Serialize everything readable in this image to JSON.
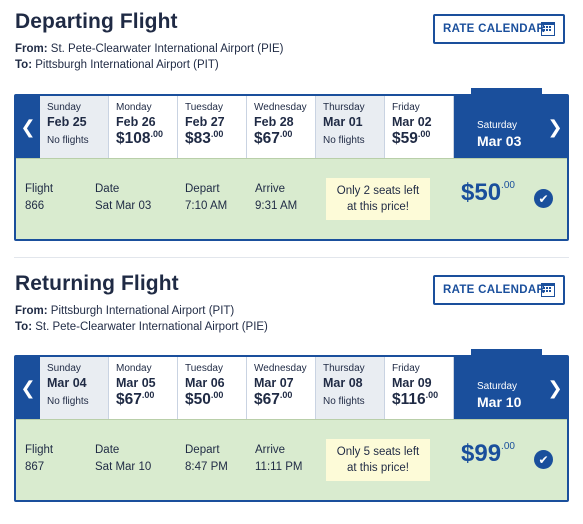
{
  "departing": {
    "title": "Departing Flight",
    "from_label": "From:",
    "from": "St. Pete-Clearwater International Airport (PIE)",
    "to_label": "To:",
    "to": "Pittsburgh International Airport (PIT)",
    "rate_calendar": "RATE CALENDAR",
    "days": [
      {
        "dow": "Sunday",
        "date": "Feb 25",
        "price": "",
        "cents": "",
        "note": "No flights",
        "grey": true
      },
      {
        "dow": "Monday",
        "date": "Feb 26",
        "price": "$108",
        "cents": ".00",
        "note": "",
        "grey": false
      },
      {
        "dow": "Tuesday",
        "date": "Feb 27",
        "price": "$83",
        "cents": ".00",
        "note": "",
        "grey": false
      },
      {
        "dow": "Wednesday",
        "date": "Feb 28",
        "price": "$67",
        "cents": ".00",
        "note": "",
        "grey": false
      },
      {
        "dow": "Thursday",
        "date": "Mar 01",
        "price": "",
        "cents": "",
        "note": "No flights",
        "grey": true
      },
      {
        "dow": "Friday",
        "date": "Mar 02",
        "price": "$59",
        "cents": ".00",
        "note": "",
        "grey": false
      }
    ],
    "selected": {
      "dow": "Saturday",
      "date": "Mar 03"
    },
    "flight_label": "Flight",
    "flight": "866",
    "date_label": "Date",
    "date": "Sat Mar 03",
    "depart_label": "Depart",
    "depart": "7:10 AM",
    "arrive_label": "Arrive",
    "arrive": "9:31 AM",
    "seats_line1": "Only 2 seats left",
    "seats_line2": "at this price!",
    "price": "$50",
    "price_cents": ".00"
  },
  "returning": {
    "title": "Returning Flight",
    "from_label": "From:",
    "from": "Pittsburgh International Airport (PIT)",
    "to_label": "To:",
    "to": "St. Pete-Clearwater International Airport (PIE)",
    "rate_calendar": "RATE CALENDAR",
    "days": [
      {
        "dow": "Sunday",
        "date": "Mar 04",
        "price": "",
        "cents": "",
        "note": "No flights",
        "grey": true
      },
      {
        "dow": "Monday",
        "date": "Mar 05",
        "price": "$67",
        "cents": ".00",
        "note": "",
        "grey": false
      },
      {
        "dow": "Tuesday",
        "date": "Mar 06",
        "price": "$50",
        "cents": ".00",
        "note": "",
        "grey": false
      },
      {
        "dow": "Wednesday",
        "date": "Mar 07",
        "price": "$67",
        "cents": ".00",
        "note": "",
        "grey": false
      },
      {
        "dow": "Thursday",
        "date": "Mar 08",
        "price": "",
        "cents": "",
        "note": "No flights",
        "grey": true
      },
      {
        "dow": "Friday",
        "date": "Mar 09",
        "price": "$116",
        "cents": ".00",
        "note": "",
        "grey": false
      }
    ],
    "selected": {
      "dow": "Saturday",
      "date": "Mar 10"
    },
    "flight_label": "Flight",
    "flight": "867",
    "date_label": "Date",
    "date": "Sat Mar 10",
    "depart_label": "Depart",
    "depart": "8:47 PM",
    "arrive_label": "Arrive",
    "arrive": "11:11 PM",
    "seats_line1": "Only 5 seats left",
    "seats_line2": "at this price!",
    "price": "$99",
    "price_cents": ".00"
  },
  "icons": {
    "prev": "chevron-left-icon",
    "next": "chevron-right-icon",
    "calendar": "calendar-icon",
    "check": "check-circle-icon"
  },
  "colors": {
    "brand": "#1a4f9c",
    "detail_bg": "#d9ebcf",
    "seats_bg": "#fdfbd8",
    "no_flight_bg": "#e9edf2"
  }
}
